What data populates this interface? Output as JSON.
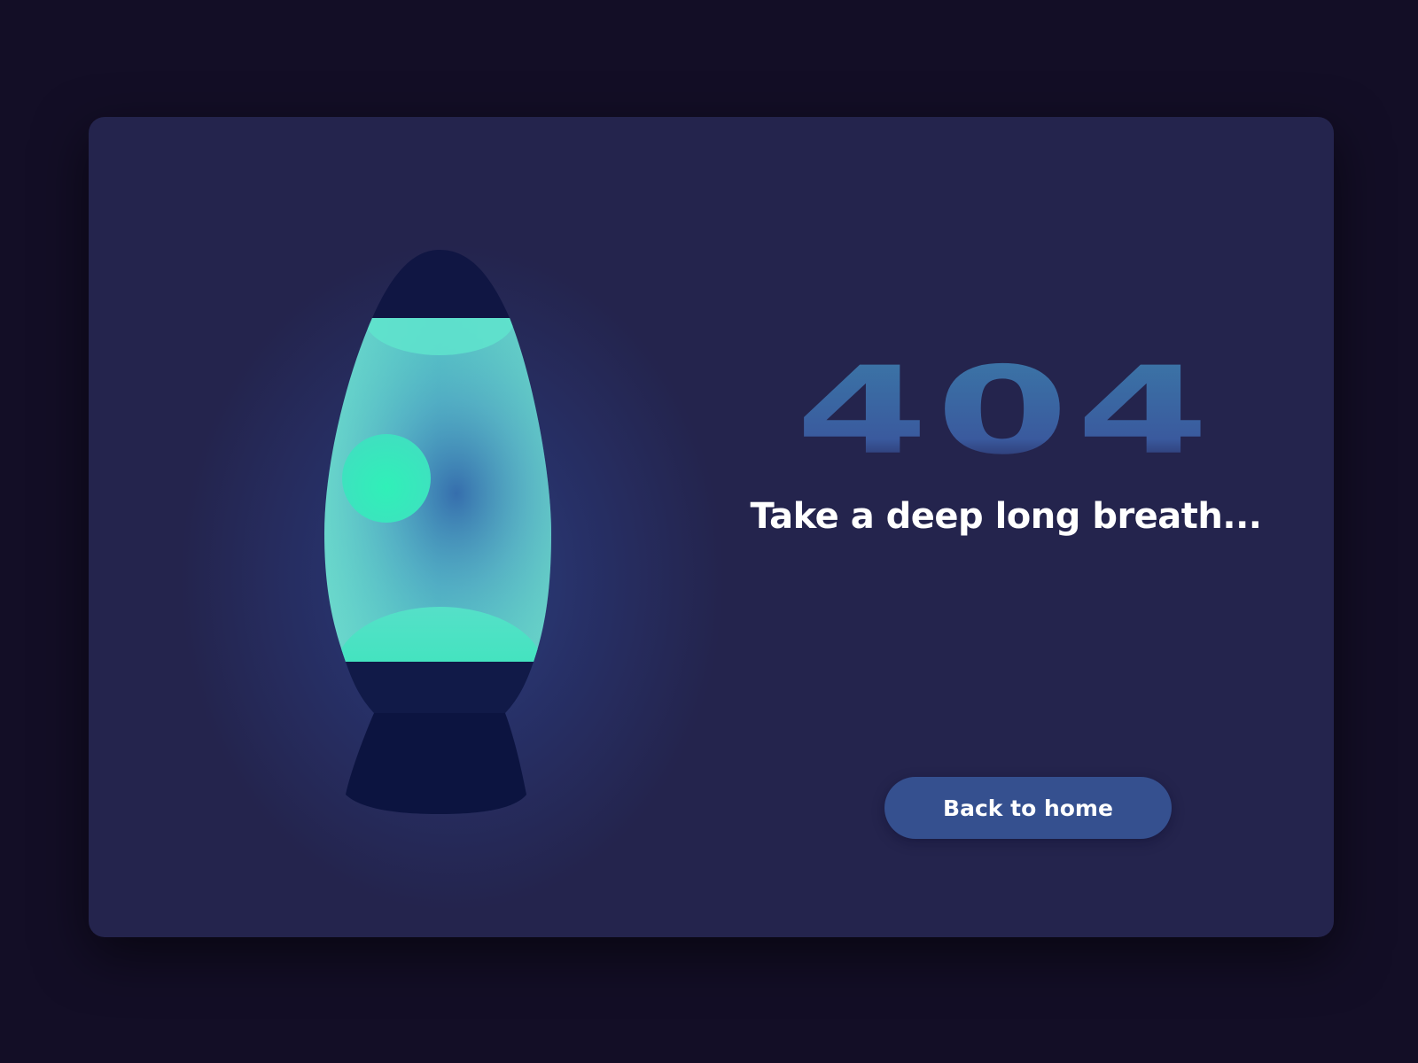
{
  "page": {
    "error_code": "404",
    "message": "Take a deep long breath...",
    "home_button_label": "Back to home"
  },
  "colors": {
    "page_background": "#130e26",
    "card_background": "#24244d",
    "lava_liquid": "#5fd8c8",
    "lava_blob": "#2de8b7",
    "lamp_cap": "#0f1542",
    "error_code_fill": "#3a60a0",
    "button_background": "#35508f",
    "text": "#ffffff"
  },
  "icons": {
    "illustration": "lava-lamp-icon"
  }
}
